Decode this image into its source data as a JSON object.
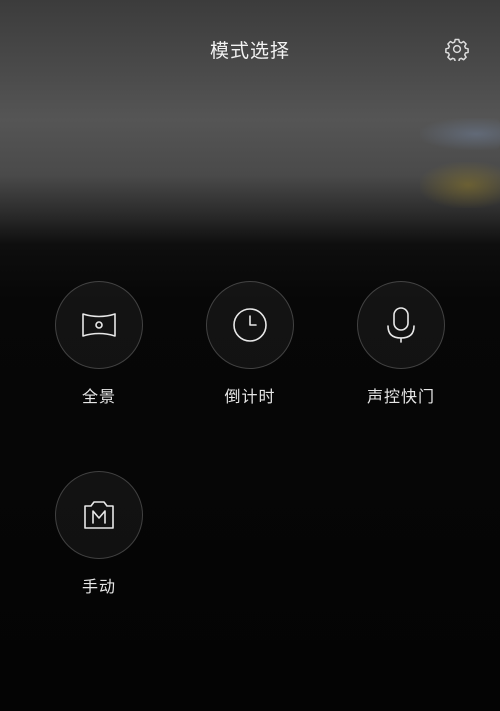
{
  "header": {
    "title": "模式选择",
    "settings_icon": "gear-icon"
  },
  "modes": [
    {
      "label": "全景",
      "icon": "panorama-icon"
    },
    {
      "label": "倒计时",
      "icon": "clock-icon"
    },
    {
      "label": "声控快门",
      "icon": "microphone-icon"
    },
    {
      "label": "手动",
      "icon": "manual-camera-icon"
    }
  ]
}
